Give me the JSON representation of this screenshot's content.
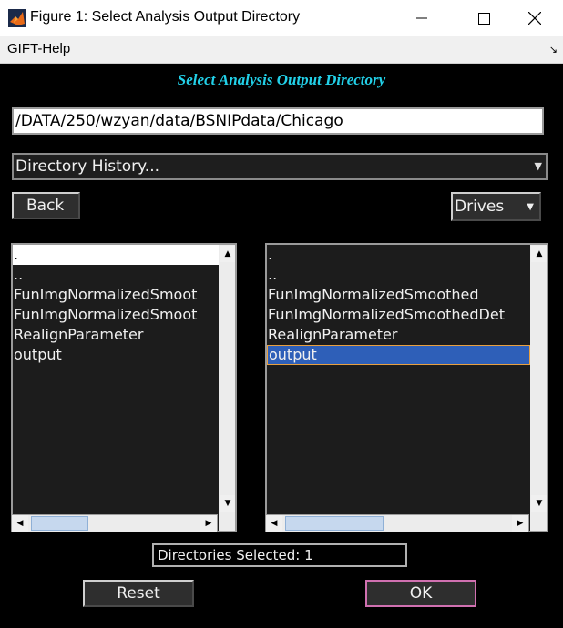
{
  "window": {
    "title": "Figure 1: Select Analysis Output Directory"
  },
  "menubar": {
    "items": [
      "GIFT-Help"
    ]
  },
  "heading": "Select Analysis Output Directory",
  "path_field": {
    "value": "/DATA/250/wzyan/data/BSNIPdata/Chicago"
  },
  "history_dropdown": {
    "label": "Directory History..."
  },
  "buttons": {
    "back": "Back",
    "drives": "Drives",
    "reset": "Reset",
    "ok": "OK"
  },
  "left_list": {
    "items": [
      ".",
      "..",
      "FunImgNormalizedSmoot",
      "FunImgNormalizedSmoot",
      "RealignParameter",
      "output"
    ]
  },
  "right_list": {
    "items": [
      ".",
      "..",
      "FunImgNormalizedSmoothed",
      "FunImgNormalizedSmoothedDet",
      "RealignParameter",
      "output"
    ],
    "selected": "output"
  },
  "status": {
    "text": "Directories Selected: 1"
  },
  "colors": {
    "heading": "#22d0e8",
    "selection": "#2e5fb8",
    "ok_border": "#d070b0"
  }
}
